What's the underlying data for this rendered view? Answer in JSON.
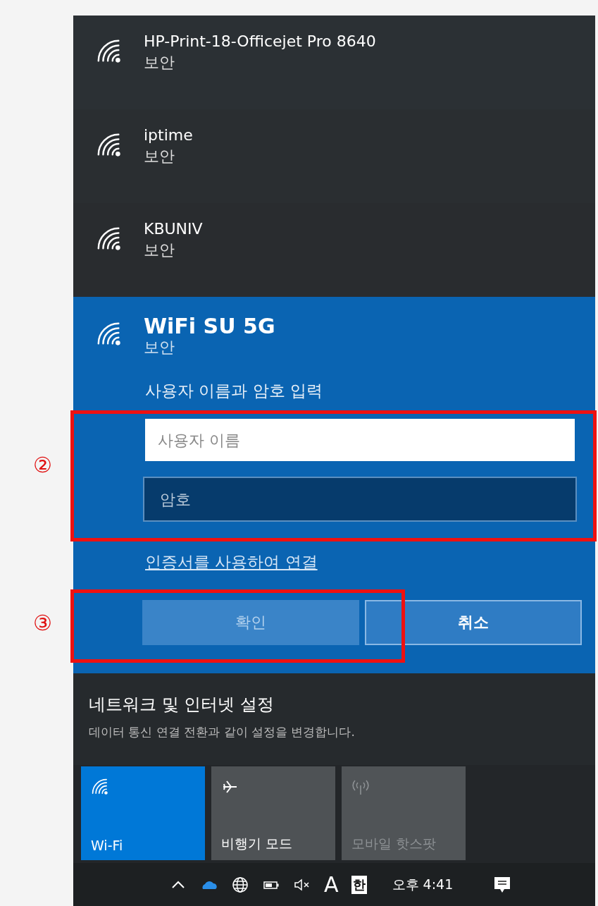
{
  "networks": [
    {
      "name": "HP-Print-18-Officejet Pro 8640",
      "status": "보안"
    },
    {
      "name": "iptime",
      "status": "보안"
    },
    {
      "name": "KBUNIV",
      "status": "보안"
    }
  ],
  "connect": {
    "name": "WiFi SU 5G",
    "status": "보안",
    "prompt": "사용자 이름과 암호 입력",
    "username": {
      "placeholder": "사용자 이름"
    },
    "password": {
      "placeholder": "암호"
    },
    "certificate_link": "인증서를 사용하여 연결",
    "buttons": [
      {
        "label": "확인",
        "disabled": true
      },
      {
        "label": "취소",
        "disabled": false
      }
    ]
  },
  "settings": {
    "title": "네트워크 및 인터넷 설정",
    "subtitle": "데이터 통신 연결 전환과 같이 설정을 변경합니다."
  },
  "quick_actions": [
    {
      "kind": "wifi",
      "label": "Wi-Fi",
      "on": true,
      "disabled": false
    },
    {
      "kind": "airplane",
      "label": "비행기 모드",
      "on": false,
      "disabled": false
    },
    {
      "kind": "hotspot",
      "label": "모바일 핫스팟",
      "on": false,
      "disabled": true
    }
  ],
  "taskbar": {
    "input_mode": "A",
    "input_language": "한",
    "time": "오후 4:41"
  },
  "annotations": [
    {
      "label": "②"
    },
    {
      "label": "③"
    }
  ]
}
